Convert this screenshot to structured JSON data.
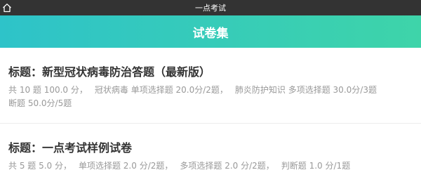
{
  "window": {
    "title": "一点考试",
    "home_icon": "home-icon"
  },
  "header": {
    "title": "试卷集"
  },
  "papers": [
    {
      "title": "标题：新型冠状病毒防治答题（最新版）",
      "summary": "共 10 题 100.0 分，",
      "sections": [
        "冠状病毒 单项选择题 20.0分/2题，",
        "肺炎防护知识 多项选择题 30.0分/3题",
        "断题 50.0分/5题"
      ]
    },
    {
      "title": "标题：一点考试样例试卷",
      "summary": "共 5 题 5.0 分，",
      "sections": [
        "单项选择题 2.0 分/2题，",
        "多项选择题 2.0 分/2题，",
        "判断题 1.0 分/1题"
      ]
    }
  ],
  "colors": {
    "titlebar": "#333333",
    "header_gradient_start": "#2ec3c9",
    "header_gradient_end": "#3ed4a9",
    "title_text": "#333333",
    "meta_text": "#999999"
  }
}
